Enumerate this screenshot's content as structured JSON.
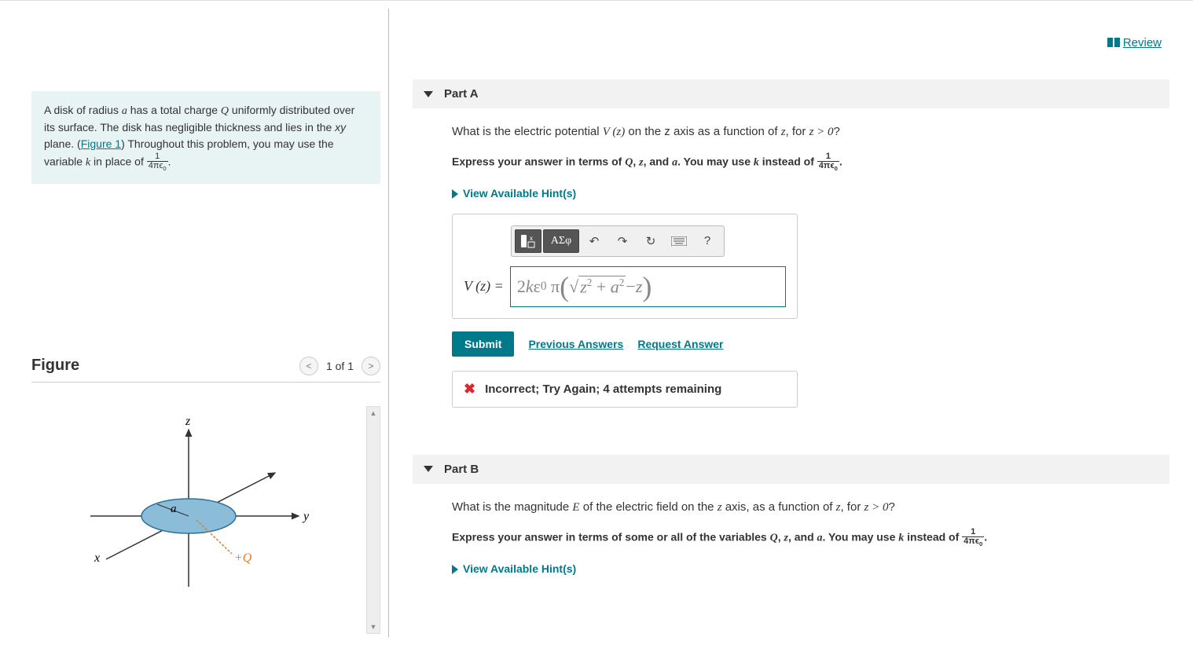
{
  "review": {
    "label": "Review"
  },
  "problem": {
    "text_1": "A disk of radius ",
    "var_a": "a",
    "text_2": " has a total charge ",
    "var_Q": "Q",
    "text_3": " uniformly distributed over its surface. The disk has negligible thickness and lies in the ",
    "xy": "xy",
    "text_4": " plane. (",
    "figure_link": "Figure 1",
    "text_5": ") Throughout this problem, you may use the variable ",
    "var_k": "k",
    "text_6": " in place of ",
    "frac_num": "1",
    "frac_den": "4πϵ0",
    "text_7": "."
  },
  "figure": {
    "title": "Figure",
    "count": "1 of 1",
    "labels": {
      "z": "z",
      "y": "y",
      "x": "x",
      "a": "a",
      "Q": "+Q"
    }
  },
  "partA": {
    "label": "Part A",
    "question_1": "What is the electric potential ",
    "Vz": "V (z)",
    "question_2": " on the z axis as a function of ",
    "z": "z",
    "question_3": ", for ",
    "cond": "z > 0",
    "question_4": "?",
    "instr_1": "Express your answer in terms of ",
    "Q": "Q",
    "comma1": ", ",
    "z2": "z",
    "comma2": ", and ",
    "a": "a",
    "instr_2": ". You may use ",
    "k": "k",
    "instr_3": " instead of ",
    "frac_num": "1",
    "frac_den": "4πϵ0",
    "instr_4": ".",
    "hints": "View Available Hint(s)",
    "eq_label": "V (z) = ",
    "eq_value": "2kε₀ π(√(z² + a²) − z)",
    "submit": "Submit",
    "prev": "Previous Answers",
    "request": "Request Answer",
    "feedback": "Incorrect; Try Again; 4 attempts remaining",
    "toolbar": {
      "greek": "ΑΣφ"
    }
  },
  "partB": {
    "label": "Part B",
    "question_1": "What is the magnitude ",
    "E": "E",
    "question_2": " of the electric field on the ",
    "z": "z",
    "question_3": " axis, as a function of ",
    "z2": "z",
    "question_4": ", for ",
    "cond": "z > 0",
    "question_5": "?",
    "instr_1": "Express your answer in terms of some or all of the variables ",
    "Q": "Q",
    "comma1": ", ",
    "z3": "z",
    "comma2": ", and ",
    "a": "a",
    "instr_2": ". You may use ",
    "k": "k",
    "instr_3": " instead of ",
    "frac_num": "1",
    "frac_den": "4πϵ0",
    "instr_4": ".",
    "hints": "View Available Hint(s)"
  }
}
